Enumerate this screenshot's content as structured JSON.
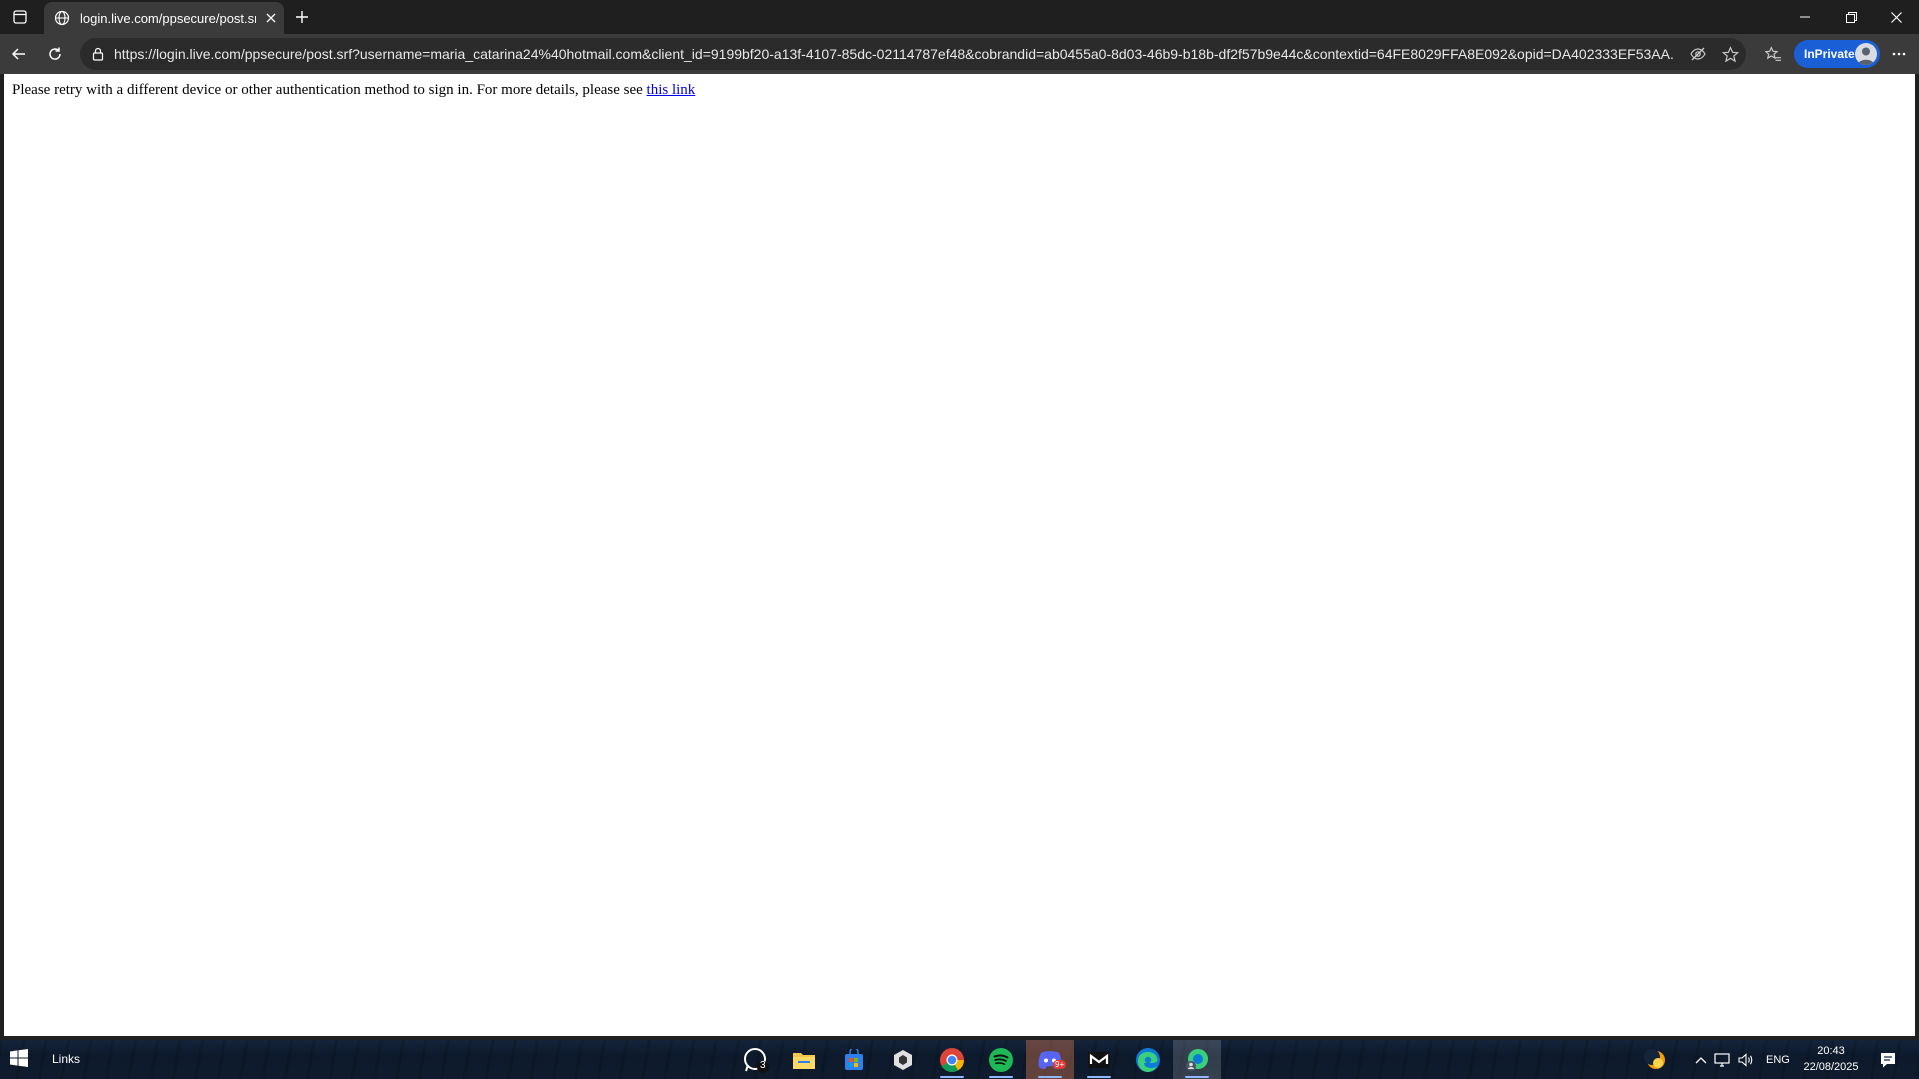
{
  "browser": {
    "tab": {
      "title": "login.live.com/ppsecure/post.srf?",
      "favicon": "globe-icon"
    },
    "address_bar": {
      "url": "https://login.live.com/ppsecure/post.srf?username=maria_catarina24%40hotmail.com&client_id=9199bf20-a13f-4107-85dc-02114787ef48&cobrandid=ab0455a0-8d03-46b9-b18b-df2f57b9e44c&contextid=64FE8029FFA8E092&opid=DA402333EF53AA..."
    },
    "inprivate_label": "InPrivate",
    "accent_color": "#1a5fd6"
  },
  "page": {
    "message": "Please retry with a different device or other authentication method to sign in. For more details, please see ",
    "link_text": "this link",
    "link_color": "#0000ee"
  },
  "taskbar": {
    "search_label": "Links",
    "apps": [
      {
        "name": "whatsapp",
        "badge": "3"
      },
      {
        "name": "file-explorer"
      },
      {
        "name": "microsoft-store"
      },
      {
        "name": "unity-hub"
      },
      {
        "name": "chrome"
      },
      {
        "name": "spotify"
      },
      {
        "name": "discord",
        "badge": "9+"
      },
      {
        "name": "epic-mail"
      },
      {
        "name": "edge"
      },
      {
        "name": "edge-inprivate"
      }
    ],
    "language": "ENG",
    "time": "20:43",
    "date": "22/08/2025"
  }
}
